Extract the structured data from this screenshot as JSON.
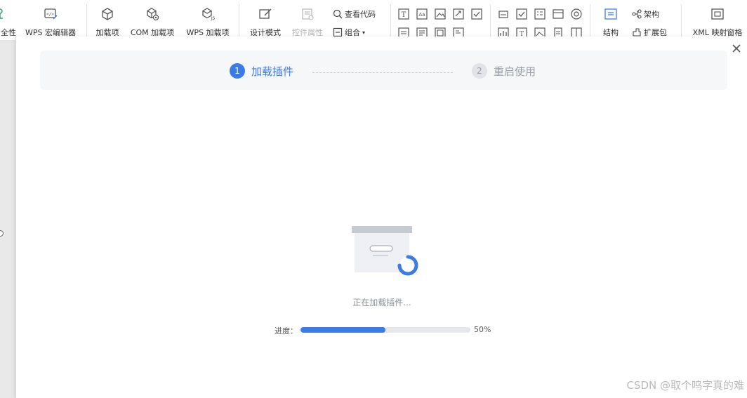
{
  "ribbon": {
    "items": [
      {
        "label": "全性",
        "icon": "security-icon"
      },
      {
        "label": "WPS 宏编辑器",
        "icon": "macro-editor-icon"
      },
      {
        "label": "加载项",
        "icon": "addin-cube-icon"
      },
      {
        "label": "COM 加载项",
        "icon": "com-addin-icon"
      },
      {
        "label": "WPS 加载项",
        "icon": "js-addin-icon"
      },
      {
        "label": "设计模式",
        "icon": "design-mode-icon"
      },
      {
        "label": "控件属性",
        "icon": "control-props-icon"
      },
      {
        "label": "结构",
        "icon": "structure-icon"
      },
      {
        "label": "XML 映射窗格",
        "icon": "xml-map-icon"
      }
    ],
    "small": {
      "view_code": "查看代码",
      "group": "组合",
      "schema": "架构",
      "expansion_pack": "扩展包"
    }
  },
  "dialog": {
    "close_icon": "close-icon",
    "steps": [
      {
        "number": "1",
        "label": "加载插件",
        "state": "active"
      },
      {
        "number": "2",
        "label": "重启使用",
        "state": "idle"
      }
    ],
    "status_text": "正在加载插件...",
    "progress": {
      "label": "进度：",
      "value": 0.5,
      "percent_text": "50%"
    }
  },
  "watermark": "CSDN @取个鸣字真的难",
  "colors": {
    "accent": "#3b7be8",
    "idle": "#9aa0a9",
    "step_bar_bg": "#f6f7f9"
  }
}
